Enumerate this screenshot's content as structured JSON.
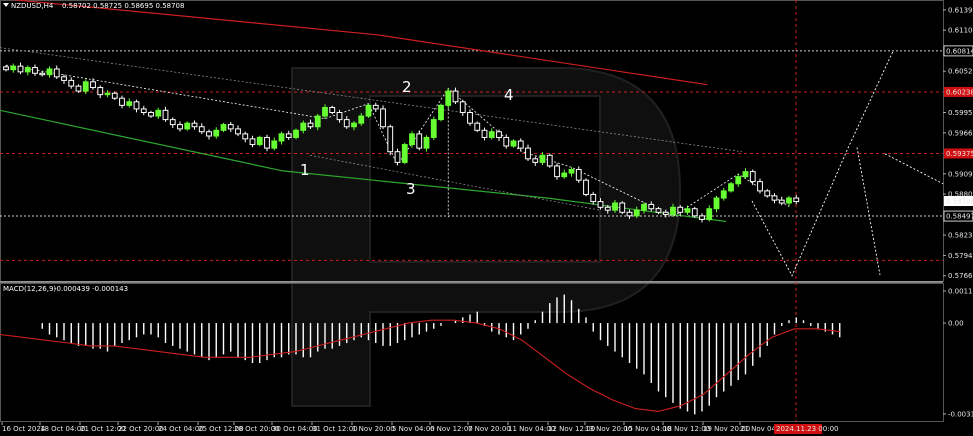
{
  "header": {
    "symbol_info": "NZDUSD,H4",
    "ohlc": "0.58702 0.58725 0.58695 0.58708"
  },
  "macd_header": {
    "label": "MACD(12,26,9)",
    "values": "-0.000439 -0.000143"
  },
  "colors": {
    "background": "#000000",
    "bull_candle": "#66ff33",
    "bear_candle": "#ffffff",
    "ema_red": "#cc1f1f",
    "ema_green": "#2fa82f",
    "macd_hist": "#ffffff",
    "macd_signal": "#cc1f1f",
    "level_red": "#cc1f1f",
    "level_white": "#cccccc",
    "current_price_bg": "#ffffff",
    "red_label_bg": "#d01010"
  },
  "chart_data": [
    {
      "type": "candlestick",
      "title": "NZDUSD,H4",
      "yaxis_ticks": [
        "0.61390",
        "0.61104",
        "0.60814",
        "0.60529",
        "0.60238",
        "0.59950",
        "0.59665",
        "0.59375",
        "0.59090",
        "0.58805",
        "0.58708",
        "0.58497",
        "0.58230",
        "0.57945",
        "0.57660"
      ],
      "ylim": [
        0.576,
        0.615
      ],
      "xaxis_ticks": [
        "16 Oct 2024",
        "18 Oct 04:00",
        "21 Oct 12:00",
        "22 Oct 20:00",
        "24 Oct 04:00",
        "25 Oct 12:00",
        "28 Oct 20:00",
        "30 Oct 04:00",
        "31 Oct 12:00",
        "1 Nov 20:00",
        "5 Nov 04:00",
        "6 Nov 12:00",
        "7 Nov 20:00",
        "11 Nov 04:00",
        "12 Nov 12:00",
        "13 Nov 20:00",
        "15 Nov 04:00",
        "18 Nov 12:00",
        "19 Nov 20:00",
        "21 Nov 04:00"
      ],
      "cursor_time_label": "2024.11.23 00:00",
      "current_price": "0.58708",
      "levels": [
        {
          "price": 0.60814,
          "style": "dotted",
          "color": "white",
          "label": "0.60814"
        },
        {
          "price": 0.60238,
          "style": "dotted",
          "color": "red",
          "label": "0.60238"
        },
        {
          "price": 0.59375,
          "style": "dotted",
          "color": "red",
          "label": "0.59375"
        },
        {
          "price": 0.58497,
          "style": "dotted",
          "color": "white",
          "label": "0.58497"
        },
        {
          "price": 0.57875,
          "style": "dotted",
          "color": "red",
          "label": "0.57875"
        }
      ],
      "wave_labels": [
        "1",
        "2",
        "3",
        "4"
      ],
      "ema_slow_points": [
        [
          0.6155,
          0
        ],
        [
          0.6104,
          0.4
        ],
        [
          0.6034,
          0.75
        ]
      ],
      "ema_fast_points": [
        [
          0.5998,
          0
        ],
        [
          0.5913,
          0.3
        ],
        [
          0.5875,
          0.58
        ],
        [
          0.5842,
          0.77
        ]
      ],
      "close_series": [
        0.6055,
        0.606,
        0.6052,
        0.6058,
        0.605,
        0.6048,
        0.6056,
        0.6045,
        0.604,
        0.6032,
        0.6025,
        0.6038,
        0.603,
        0.602,
        0.6022,
        0.6015,
        0.6005,
        0.601,
        0.6,
        0.5995,
        0.599,
        0.5998,
        0.5985,
        0.5978,
        0.5972,
        0.598,
        0.5975,
        0.5968,
        0.5962,
        0.597,
        0.5978,
        0.5972,
        0.5965,
        0.5958,
        0.595,
        0.596,
        0.5945,
        0.5955,
        0.5965,
        0.596,
        0.597,
        0.598,
        0.5975,
        0.599,
        0.6002,
        0.5995,
        0.5985,
        0.5975,
        0.598,
        0.599,
        0.6005,
        0.6,
        0.5975,
        0.594,
        0.5925,
        0.595,
        0.5965,
        0.5945,
        0.596,
        0.5985,
        0.6005,
        0.6025,
        0.601,
        0.5995,
        0.598,
        0.597,
        0.596,
        0.5968,
        0.596,
        0.5948,
        0.5955,
        0.5945,
        0.593,
        0.5925,
        0.5935,
        0.592,
        0.5905,
        0.591,
        0.5915,
        0.59,
        0.588,
        0.587,
        0.5862,
        0.5858,
        0.5868,
        0.5855,
        0.585,
        0.5858,
        0.5866,
        0.586,
        0.5855,
        0.5852,
        0.5862,
        0.5855,
        0.586,
        0.585,
        0.5845,
        0.586,
        0.5875,
        0.5885,
        0.5895,
        0.5905,
        0.5912,
        0.5898,
        0.5885,
        0.5878,
        0.5872,
        0.5868,
        0.5875,
        0.587
      ],
      "forecast_path": [
        [
          0.58708,
          0
        ],
        [
          0.5766,
          0.13
        ],
        [
          0.5945,
          0.32
        ],
        [
          0.6081,
          0.48
        ]
      ],
      "alt_forecast_path": [
        [
          0.5946,
          0
        ],
        [
          0.5767,
          0.33
        ]
      ]
    },
    {
      "type": "bar",
      "title": "MACD(12,26,9)",
      "yaxis_ticks": [
        "0.001123",
        "0.00",
        "-0.003189"
      ],
      "ylim": [
        -0.0034,
        0.0013
      ],
      "histogram": [
        0.0,
        0.0,
        0.0,
        0.0,
        0.0,
        -0.0002,
        -0.0004,
        -0.0005,
        -0.0006,
        -0.0007,
        -0.0008,
        -0.0008,
        -0.0009,
        -0.0009,
        -0.001,
        -0.0008,
        -0.0007,
        -0.0006,
        -0.0005,
        -0.0004,
        -0.0004,
        -0.0005,
        -0.0007,
        -0.0008,
        -0.0009,
        -0.001,
        -0.0011,
        -0.0012,
        -0.0013,
        -0.0012,
        -0.0011,
        -0.001,
        -0.0012,
        -0.0013,
        -0.0014,
        -0.0014,
        -0.0013,
        -0.0012,
        -0.0012,
        -0.0011,
        -0.0011,
        -0.0012,
        -0.0012,
        -0.001,
        -0.0009,
        -0.0009,
        -0.0008,
        -0.0007,
        -0.0006,
        -0.0005,
        -0.0006,
        -0.0007,
        -0.0008,
        -0.0008,
        -0.0007,
        -0.0006,
        -0.0005,
        -0.0004,
        -0.0003,
        -0.0002,
        -0.0001,
        0.0,
        0.0001,
        0.0002,
        0.0003,
        0.0004,
        -0.0001,
        -0.0003,
        -0.0004,
        -0.0005,
        -0.0006,
        -0.0004,
        -0.0002,
        0.0001,
        0.0004,
        0.0007,
        0.0009,
        0.001,
        0.0008,
        0.0005,
        0.0002,
        -0.0003,
        -0.0006,
        -0.0008,
        -0.001,
        -0.0012,
        -0.0014,
        -0.0016,
        -0.0018,
        -0.0021,
        -0.0024,
        -0.0026,
        -0.0028,
        -0.003,
        -0.0031,
        -0.0032,
        -0.0031,
        -0.0029,
        -0.0026,
        -0.0024,
        -0.0022,
        -0.002,
        -0.0018,
        -0.0015,
        -0.0012,
        -0.0008,
        -0.0004,
        -0.0001,
        0.0001,
        0.0002,
        0.0001,
        -0.0001,
        -0.0002,
        -0.0003,
        -0.0004,
        -0.0005
      ],
      "signal": [
        -0.0004,
        -0.0005,
        -0.0006,
        -0.0007,
        -0.0008,
        -0.0008,
        -0.0009,
        -0.001,
        -0.0011,
        -0.0012,
        -0.0012,
        -0.0012,
        -0.0011,
        -0.001,
        -0.0008,
        -0.0006,
        -0.0004,
        -0.0002,
        0.0,
        0.0001,
        0.0001,
        0.0,
        -0.0002,
        -0.0006,
        -0.0012,
        -0.0018,
        -0.0023,
        -0.0027,
        -0.003,
        -0.0031,
        -0.0029,
        -0.0025,
        -0.0018,
        -0.0011,
        -0.0005,
        -0.0002,
        -0.0002,
        -0.0003
      ]
    }
  ]
}
